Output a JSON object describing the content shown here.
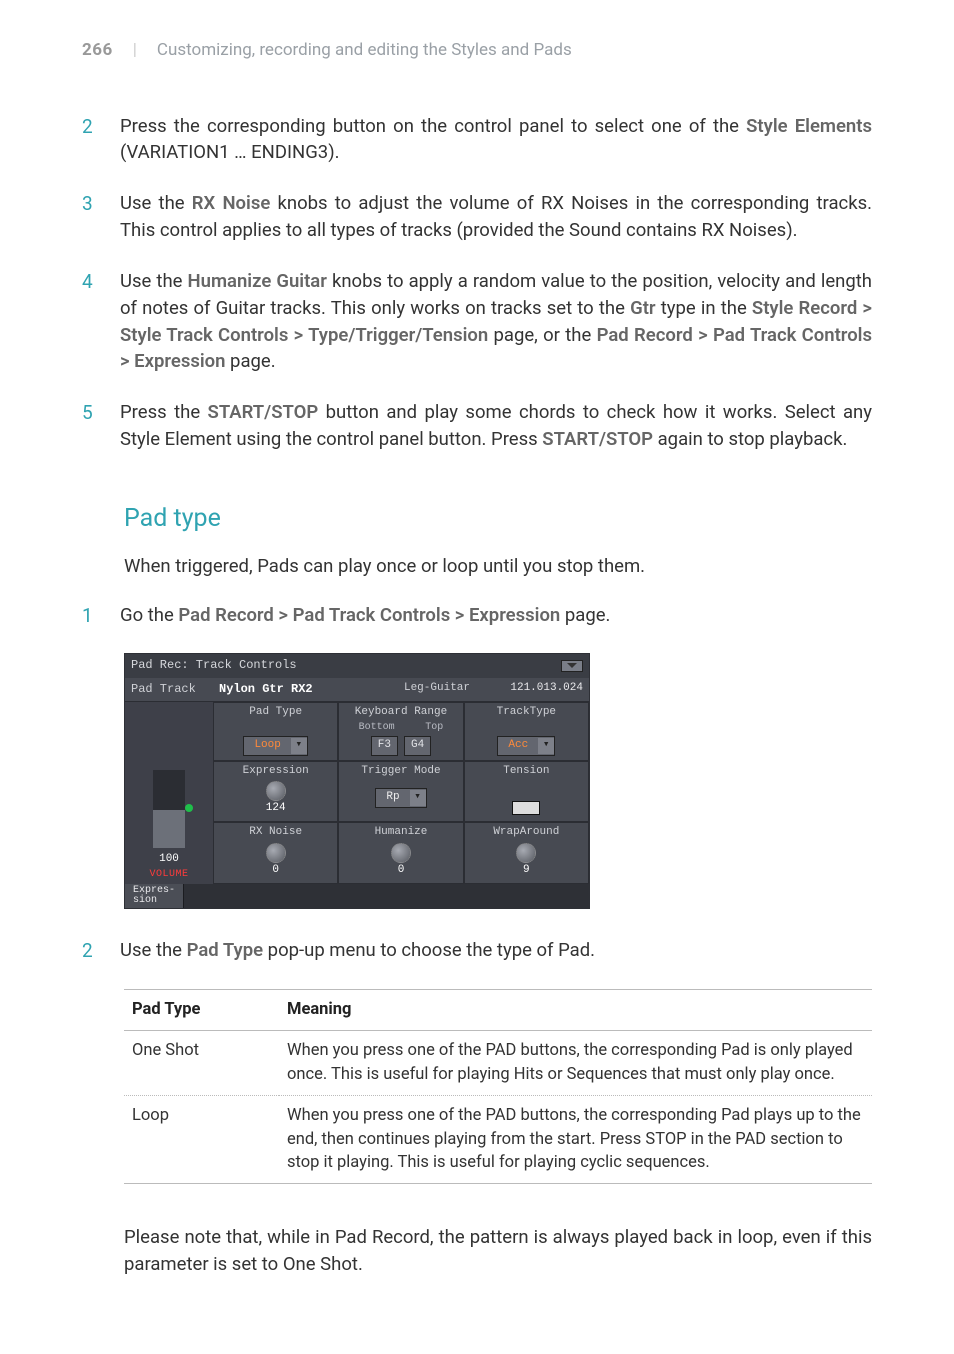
{
  "page": {
    "number": "266",
    "divider": "|",
    "chapter": "Customizing, recording and editing the Styles and Pads"
  },
  "steps_a": [
    {
      "n": "2",
      "text_pre": "Press the corresponding button on the control panel to select one of the ",
      "bold": "Style Elements",
      "text_post": " (VARIATION1 … ENDING3)."
    },
    {
      "n": "3",
      "segments": [
        {
          "t": "Use the "
        },
        {
          "b": "RX Noise"
        },
        {
          "t": " knobs to adjust the volume of RX Noises in the corresponding tracks. This control applies to all types of tracks (provided the Sound contains RX Noises)."
        }
      ]
    },
    {
      "n": "4",
      "segments": [
        {
          "t": "Use the "
        },
        {
          "b": "Humanize Guitar"
        },
        {
          "t": " knobs to apply a random value to the position, velocity and length of notes of Guitar tracks. This only works on tracks set to the "
        },
        {
          "b": "Gtr"
        },
        {
          "t": " type in the "
        },
        {
          "b": "Style Record > Style Track Controls > Type/Trigger/Tension"
        },
        {
          "t": " page, or the "
        },
        {
          "b": "Pad Record > Pad Track Controls > Expression"
        },
        {
          "t": " page."
        }
      ]
    },
    {
      "n": "5",
      "segments": [
        {
          "t": "Press the "
        },
        {
          "b": "START/STOP"
        },
        {
          "t": " button and play some chords to check how it works. Select any Style Element using the control panel button. Press "
        },
        {
          "b": "START/STOP"
        },
        {
          "t": " again to stop playback."
        }
      ]
    }
  ],
  "section_title": "Pad type",
  "lead": "When triggered, Pads can play once or loop until you stop them.",
  "steps_b": [
    {
      "n": "1",
      "segments": [
        {
          "t": "Go the "
        },
        {
          "b": "Pad Record > Pad Track Controls > Expression"
        },
        {
          "t": " page."
        }
      ]
    }
  ],
  "shot": {
    "title": "Pad Rec: Track Controls",
    "row": {
      "c1": "Pad Track",
      "c2": "Nylon Gtr RX2",
      "c3": "Leg-Guitar",
      "c4": "121.013.024"
    },
    "left": {
      "volnum": "100",
      "vollabel": "VOLUME"
    },
    "r1": {
      "a": {
        "label": "Pad Type",
        "value": "Loop"
      },
      "b": {
        "label": "Keyboard Range",
        "sub1": "Bottom",
        "sub2": "Top",
        "v1": "F3",
        "v2": "G4"
      },
      "c": {
        "label": "TrackType",
        "value": "Acc"
      }
    },
    "r2": {
      "a": {
        "label": "Expression",
        "value": "124"
      },
      "b": {
        "label": "Trigger Mode",
        "value": "Rp"
      },
      "c": {
        "label": "Tension"
      }
    },
    "r3": {
      "a": {
        "label": "RX Noise",
        "value": "0"
      },
      "b": {
        "label": "Humanize",
        "value": "0"
      },
      "c": {
        "label": "WrapAround",
        "value": "9"
      }
    },
    "tab": "Expres-\nsion"
  },
  "steps_c": [
    {
      "n": "2",
      "segments": [
        {
          "t": "Use the "
        },
        {
          "b": "Pad Type"
        },
        {
          "t": " pop-up menu to choose the type of Pad."
        }
      ]
    }
  ],
  "table": {
    "h1": "Pad Type",
    "h2": "Meaning",
    "rows": [
      {
        "k": "One Shot",
        "v": "When you press one of the PAD buttons, the corresponding Pad is only played once. This is useful for playing Hits or Sequences that must only play once."
      },
      {
        "k": "Loop",
        "v": "When you press one of the PAD buttons, the corresponding Pad plays up to the end, then continues playing from the start. Press STOP in the PAD section to stop it playing. This is useful for playing cyclic sequences."
      }
    ]
  },
  "note": "Please note that, while in Pad Record, the pattern is always played back in loop, even if this parameter is set to One Shot."
}
